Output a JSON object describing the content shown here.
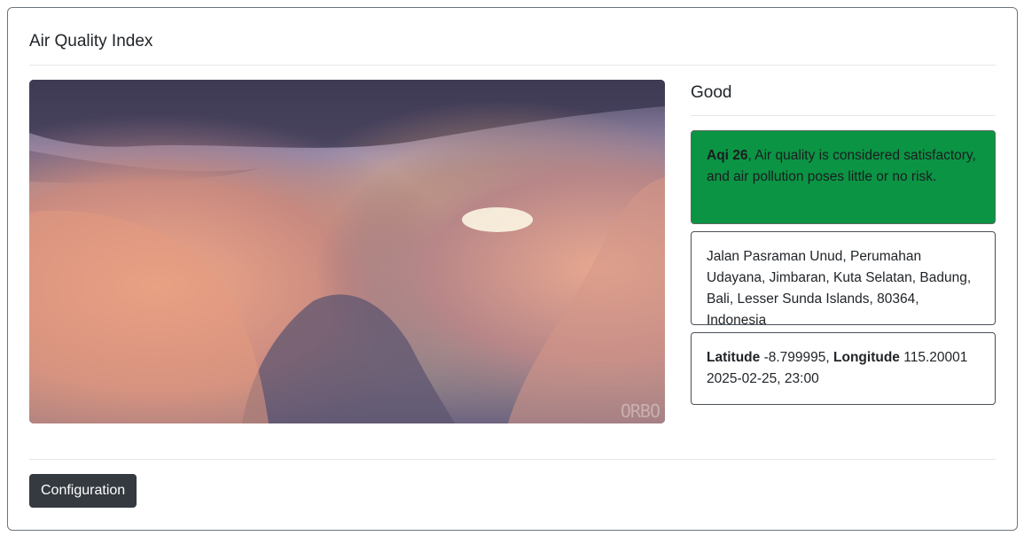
{
  "card": {
    "title": "Air Quality Index"
  },
  "image": {
    "alt": "Sunset above clouds",
    "watermark": "ORBO"
  },
  "status": {
    "label": "Good",
    "color": "#0b9444"
  },
  "aqi": {
    "prefix": "Aqi 26",
    "description": ", Air quality is considered satisfactory, and air pollution poses little or no risk."
  },
  "location": {
    "address": "Jalan Pasraman Unud, Perumahan Udayana, Jimbaran, Kuta Selatan, Badung, Bali, Lesser Sunda Islands, 80364, Indonesia"
  },
  "coordinates": {
    "latitude_label": "Latitude",
    "latitude_value": " -8.799995, ",
    "longitude_label": "Longitude",
    "longitude_value": " 115.20001",
    "timestamp": "2025-02-25, 23:00"
  },
  "footer": {
    "config_button": "Configuration"
  }
}
